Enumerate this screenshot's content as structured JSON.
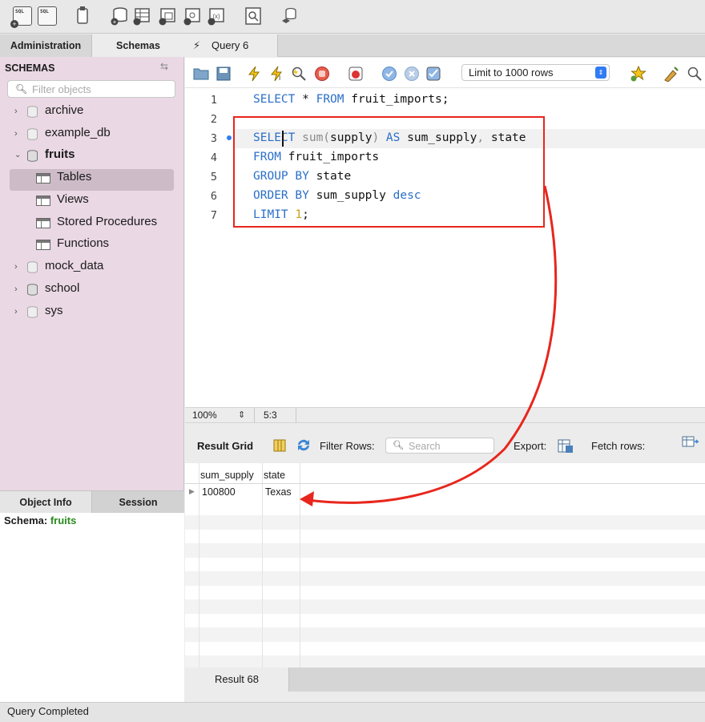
{
  "toolbar": {
    "icons": [
      "new-sql-tab-icon",
      "open-sql-script-icon",
      "inspector-icon",
      "create-schema-icon",
      "create-table-icon",
      "create-view-icon",
      "create-procedure-icon",
      "create-function-icon",
      "search-table-data-icon",
      "reconnect-icon"
    ],
    "sql_label": "SQL"
  },
  "sidebar": {
    "tabs": [
      "Administration",
      "Schemas"
    ],
    "header": "SCHEMAS",
    "filter_placeholder": "Filter objects",
    "schemas": [
      "archive",
      "example_db",
      "fruits",
      "mock_data",
      "school",
      "sys"
    ],
    "fruits_children": [
      "Tables",
      "Views",
      "Stored Procedures",
      "Functions"
    ],
    "selected_item": "Tables"
  },
  "object_info": {
    "tabs": [
      "Object Info",
      "Session"
    ],
    "schema_label": "Schema:",
    "schema_value": "fruits"
  },
  "query_tab": {
    "label": "Query 6"
  },
  "editor_toolbar": {
    "limit_label": "Limit to 1000 rows",
    "icons": [
      "open-file-icon",
      "save-icon",
      "execute-icon",
      "execute-current-icon",
      "explain-icon",
      "stop-icon",
      "toggle-error-icon",
      "commit-icon",
      "rollback-icon",
      "autocommit-icon",
      "add-snippet-icon",
      "beautify-icon",
      "find-icon"
    ]
  },
  "editor": {
    "line_numbers": [
      "1",
      "2",
      "3",
      "4",
      "5",
      "6",
      "7"
    ],
    "lines": {
      "l1": {
        "kw1": "SELECT",
        "t1": " * ",
        "kw2": "FROM",
        "t2": " fruit_imports;"
      },
      "l3": {
        "kw1": "SELECT",
        "fn": " sum(",
        "t1": "supply",
        "fn2": ")",
        "kw2": " AS",
        "t2": " sum_supply",
        "fn3": ",",
        "t3": " state"
      },
      "l4": {
        "kw1": "FROM",
        "t1": " fruit_imports"
      },
      "l5": {
        "kw1": "GROUP BY",
        "t1": " state"
      },
      "l6": {
        "kw1": "ORDER BY",
        "t1": " sum_supply ",
        "kw2": "desc"
      },
      "l7": {
        "kw1": "LIMIT",
        "t1": " ",
        "num": "1",
        "t2": ";"
      }
    },
    "accent_color": "#e8261d"
  },
  "status_strip": {
    "zoom": "100%",
    "cursor": "5:3"
  },
  "result_toolbar": {
    "result_grid_label": "Result Grid",
    "filter_rows_label": "Filter Rows:",
    "search_placeholder": "Search",
    "export_label": "Export:",
    "fetch_rows_label": "Fetch rows:"
  },
  "result_grid": {
    "columns": [
      "sum_supply",
      "state"
    ],
    "rows": [
      [
        "100800",
        "Texas"
      ]
    ]
  },
  "result_tab": {
    "label": "Result 68"
  },
  "status_bar": {
    "text": "Query Completed"
  }
}
